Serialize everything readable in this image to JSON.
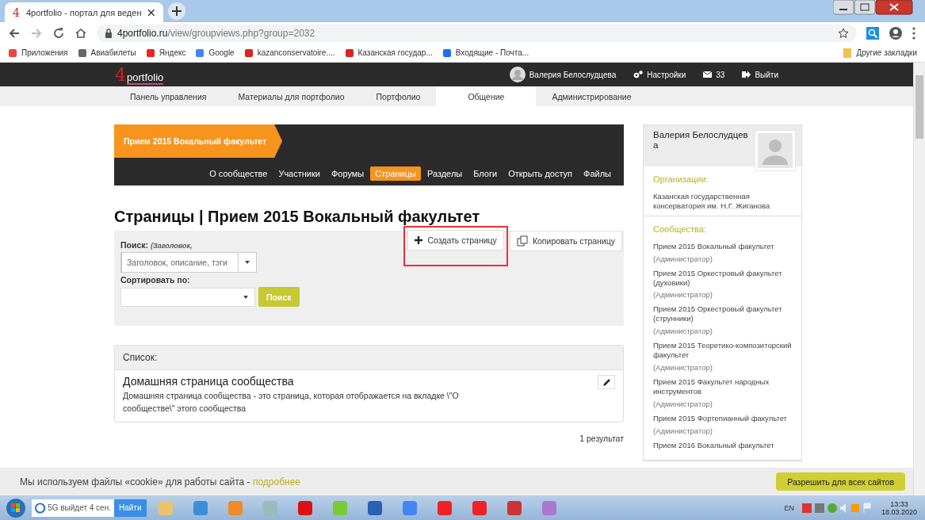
{
  "browser": {
    "favicon": "4",
    "tab_title": "4portfolio - портал для веден",
    "url_host": "4portfolio.ru",
    "url_path": "/view/groupviews.php?group=2032",
    "bookmarks": [
      "Приложения",
      "Авиабилеты",
      "Яндекс",
      "Google",
      "kazanconservatoire....",
      "Казанская государ...",
      "Входящие - Почта..."
    ],
    "other_bookmarks": "Другие закладки"
  },
  "site": {
    "logo_digit": "4",
    "logo_word": "portfolio",
    "user": "Валерия Белослудцева",
    "settings": "Настройки",
    "messages": "33",
    "logout": "Выйти",
    "nav": [
      {
        "label": "Панель управления",
        "selected": false
      },
      {
        "label": "Материалы для портфолио",
        "selected": false
      },
      {
        "label": "Портфолио",
        "selected": false
      },
      {
        "label": "Общение",
        "selected": true
      },
      {
        "label": "Администрирование",
        "selected": false
      }
    ]
  },
  "group": {
    "title": "Прием 2015 Вокальный факультет",
    "tabs": [
      {
        "label": "О сообществе",
        "selected": false
      },
      {
        "label": "Участники",
        "selected": false
      },
      {
        "label": "Форумы",
        "selected": false
      },
      {
        "label": "Страницы",
        "selected": true
      },
      {
        "label": "Разделы",
        "selected": false
      },
      {
        "label": "Блоги",
        "selected": false
      },
      {
        "label": "Открыть доступ",
        "selected": false
      },
      {
        "label": "Файлы",
        "selected": false
      }
    ]
  },
  "heading": "Страницы | Прием 2015 Вокальный факультет",
  "search": {
    "label": "Поиск:",
    "hint": "(Заголовок,",
    "placeholder": "Заголовок, описание, тэги",
    "sort_label": "Сортировать по:",
    "button": "Поиск"
  },
  "actions": [
    {
      "label": "Создать страницу",
      "kind": "create",
      "highlighted": true
    },
    {
      "label": "Копировать страницу",
      "kind": "copy",
      "highlighted": false
    }
  ],
  "list": {
    "title": "Список:",
    "items": [
      {
        "title": "Домашняя страница сообщества",
        "description": "Домашняя страница сообщества - это страница, которая отображается на вкладке \\\"О сообществе\\\" этого сообщества"
      }
    ],
    "results": "1 результат"
  },
  "profile": {
    "name": "Валерия Белослудцева",
    "organizations_title": "Организации:",
    "organization": "Казанская государственная консерватория им. Н.Г. Жиганова",
    "communities_title": "Сообщества:",
    "communities": [
      {
        "name": "Прием 2015 Вокальный факультет",
        "role": "(Администратор)"
      },
      {
        "name": "Прием 2015 Оркестровый факультет (духовики)",
        "role": "(Администратор)"
      },
      {
        "name": "Прием 2015 Оркестровый факультет (струнники)",
        "role": "(Администратор)"
      },
      {
        "name": "Прием 2015 Теоретико-композиторский факультет",
        "role": "(Администратор)"
      },
      {
        "name": "Прием 2015 Факультет народных инструментов",
        "role": "(Администратор)"
      },
      {
        "name": "Прием 2015 Фортепианный факультет",
        "role": "(Администратор)"
      },
      {
        "name": "Прием 2016 Вокальный факультет"
      }
    ]
  },
  "cookie": {
    "text": "Мы используем файлы «cookie» для работы сайта - ",
    "link": "подробнее",
    "button": "Разрешить для всех сайтов"
  },
  "taskbar": {
    "search": "5G выйдет 4 сен.",
    "search_button": "Найти",
    "lang": "EN",
    "time": "13:33",
    "date": "18.03.2020"
  }
}
